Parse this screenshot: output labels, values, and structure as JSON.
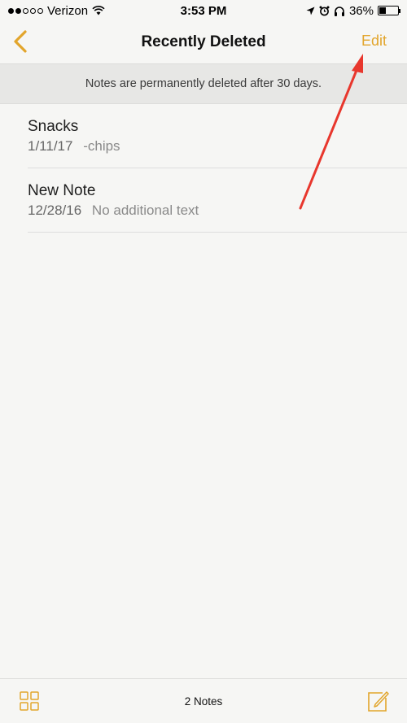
{
  "status_bar": {
    "carrier": "Verizon",
    "time": "3:53 PM",
    "battery": "36%",
    "battery_level": 0.36,
    "signal_bars_filled": 2,
    "signal_bars_total": 5
  },
  "nav": {
    "title": "Recently Deleted",
    "edit_label": "Edit",
    "back_icon": "chevron-left-icon"
  },
  "banner": {
    "text": "Notes are permanently deleted after 30 days."
  },
  "notes": [
    {
      "title": "Snacks",
      "date": "1/11/17",
      "preview": "-chips"
    },
    {
      "title": "New Note",
      "date": "12/28/16",
      "preview": "No additional text"
    }
  ],
  "toolbar": {
    "count_label": "2 Notes",
    "gallery_icon": "grid-icon",
    "compose_icon": "compose-icon"
  },
  "colors": {
    "accent": "#e2a52b",
    "annotation_arrow": "#e8372d"
  }
}
